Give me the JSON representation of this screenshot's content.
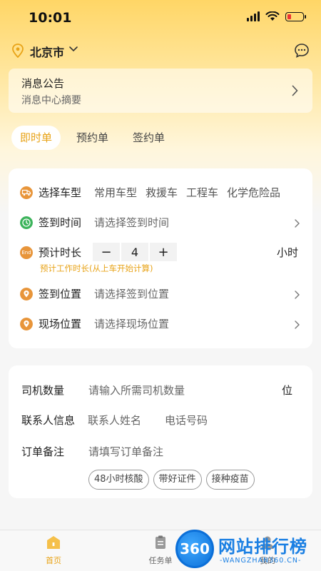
{
  "status_bar": {
    "time": "10:01"
  },
  "header": {
    "city": "北京市"
  },
  "notice": {
    "title": "消息公告",
    "subtitle": "消息中心摘要"
  },
  "tabs": [
    {
      "label": "即时单",
      "active": true
    },
    {
      "label": "预约单",
      "active": false
    },
    {
      "label": "签约单",
      "active": false
    }
  ],
  "order_form": {
    "vehicle_type": {
      "label": "选择车型",
      "options": [
        "常用车型",
        "救援车",
        "工程车",
        "化学危险品"
      ]
    },
    "checkin_time": {
      "label": "签到时间",
      "placeholder": "请选择签到时间"
    },
    "duration": {
      "label": "预计时长",
      "badge": "End",
      "minus": "−",
      "value": "4",
      "plus": "+",
      "unit": "小时",
      "hint": "预计工作时长(从上车开始计算)"
    },
    "checkin_location": {
      "label": "签到位置",
      "placeholder": "请选择签到位置"
    },
    "site_location": {
      "label": "现场位置",
      "placeholder": "请选择现场位置"
    }
  },
  "driver_form": {
    "driver_count": {
      "label": "司机数量",
      "placeholder": "请输入所需司机数量",
      "unit": "位"
    },
    "contact": {
      "label": "联系人信息",
      "name_placeholder": "联系人姓名",
      "phone_placeholder": "电话号码"
    },
    "remark": {
      "label": "订单备注",
      "placeholder": "请填写订单备注"
    },
    "chips": [
      "48小时核酸",
      "带好证件",
      "接种疫苗"
    ]
  },
  "bottom_nav": [
    {
      "label": "首页",
      "active": true
    },
    {
      "label": "任务单",
      "active": false
    },
    {
      "label": "我的",
      "active": false
    }
  ],
  "watermark": {
    "logo": "360",
    "text": "网站排行榜",
    "url": "-WANGZHAN360.CN-"
  },
  "colors": {
    "accent": "#E8A317",
    "header_yellow": "#FFD666",
    "icon_orange": "#E8953A",
    "icon_green": "#3BB35A",
    "watermark_blue": "#1A7FE3"
  }
}
